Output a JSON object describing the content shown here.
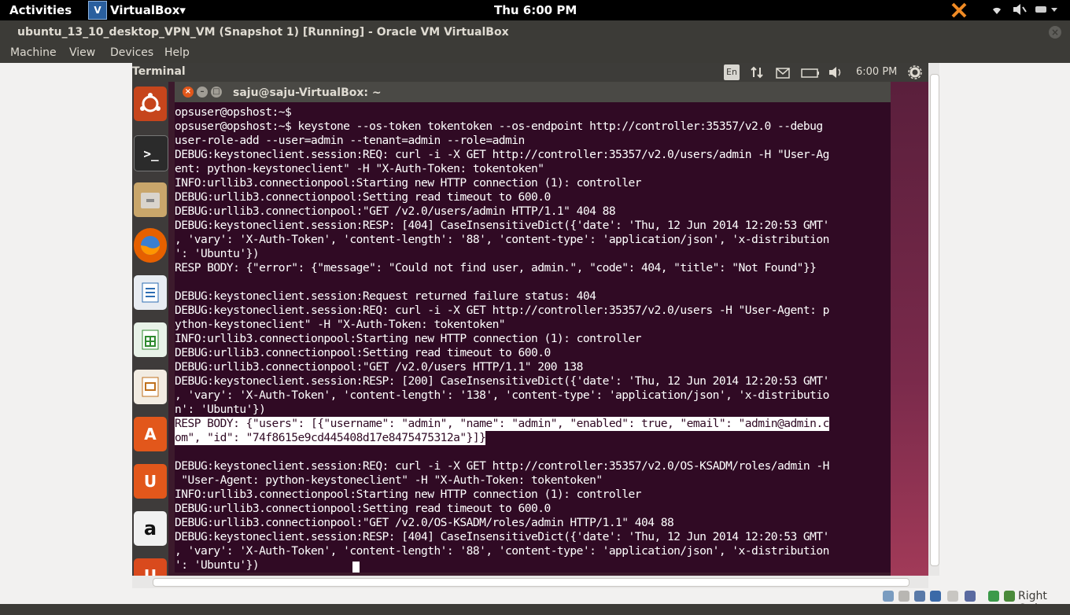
{
  "host_topbar": {
    "activities": "Activities",
    "app_name": "VirtualBox",
    "app_caret": "▾",
    "clock": "Thu  6:00 PM"
  },
  "window": {
    "title": "ubuntu_13_10_desktop_VPN_VM (Snapshot 1) [Running] - Oracle VM VirtualBox",
    "close": "×",
    "menu": [
      "Machine",
      "View",
      "Devices",
      "Help"
    ]
  },
  "guest": {
    "app_title": "Terminal",
    "keyboard_layout": "En",
    "clock": "6:00 PM"
  },
  "terminal": {
    "title": "saju@saju-VirtualBox: ~",
    "lines": [
      "opsuser@opshost:~$",
      "opsuser@opshost:~$ keystone --os-token tokentoken --os-endpoint http://controller:35357/v2.0 --debug",
      "user-role-add --user=admin --tenant=admin --role=admin",
      "DEBUG:keystoneclient.session:REQ: curl -i -X GET http://controller:35357/v2.0/users/admin -H \"User-Ag",
      "ent: python-keystoneclient\" -H \"X-Auth-Token: tokentoken\"",
      "INFO:urllib3.connectionpool:Starting new HTTP connection (1): controller",
      "DEBUG:urllib3.connectionpool:Setting read timeout to 600.0",
      "DEBUG:urllib3.connectionpool:\"GET /v2.0/users/admin HTTP/1.1\" 404 88",
      "DEBUG:keystoneclient.session:RESP: [404] CaseInsensitiveDict({'date': 'Thu, 12 Jun 2014 12:20:53 GMT'",
      ", 'vary': 'X-Auth-Token', 'content-length': '88', 'content-type': 'application/json', 'x-distribution",
      "': 'Ubuntu'})",
      "RESP BODY: {\"error\": {\"message\": \"Could not find user, admin.\", \"code\": 404, \"title\": \"Not Found\"}}",
      "",
      "DEBUG:keystoneclient.session:Request returned failure status: 404",
      "DEBUG:keystoneclient.session:REQ: curl -i -X GET http://controller:35357/v2.0/users -H \"User-Agent: p",
      "ython-keystoneclient\" -H \"X-Auth-Token: tokentoken\"",
      "INFO:urllib3.connectionpool:Starting new HTTP connection (1): controller",
      "DEBUG:urllib3.connectionpool:Setting read timeout to 600.0",
      "DEBUG:urllib3.connectionpool:\"GET /v2.0/users HTTP/1.1\" 200 138",
      "DEBUG:keystoneclient.session:RESP: [200] CaseInsensitiveDict({'date': 'Thu, 12 Jun 2014 12:20:53 GMT'",
      ", 'vary': 'X-Auth-Token', 'content-length': '138', 'content-type': 'application/json', 'x-distributio",
      "n': 'Ubuntu'})",
      "RESP BODY: {\"users\": [{\"username\": \"admin\", \"name\": \"admin\", \"enabled\": true, \"email\": \"admin@admin.c",
      "om\", \"id\": \"74f8615e9cd445408d17e8475475312a\"}]}",
      "",
      "DEBUG:keystoneclient.session:REQ: curl -i -X GET http://controller:35357/v2.0/OS-KSADM/roles/admin -H",
      " \"User-Agent: python-keystoneclient\" -H \"X-Auth-Token: tokentoken\"",
      "INFO:urllib3.connectionpool:Starting new HTTP connection (1): controller",
      "DEBUG:urllib3.connectionpool:Setting read timeout to 600.0",
      "DEBUG:urllib3.connectionpool:\"GET /v2.0/OS-KSADM/roles/admin HTTP/1.1\" 404 88",
      "DEBUG:keystoneclient.session:RESP: [404] CaseInsensitiveDict({'date': 'Thu, 12 Jun 2014 12:20:53 GMT'",
      ", 'vary': 'X-Auth-Token', 'content-length': '88', 'content-type': 'application/json', 'x-distribution",
      "': 'Ubuntu'})"
    ],
    "selected_lines": [
      22,
      23
    ]
  },
  "statusbar": {
    "host_key": "Right Ctrl"
  }
}
